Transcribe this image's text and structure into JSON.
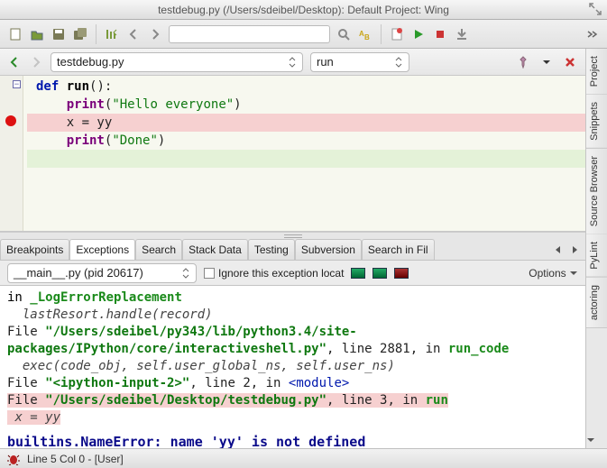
{
  "window": {
    "title": "testdebug.py (/Users/sdeibel/Desktop): Default Project: Wing"
  },
  "file_tabs": {
    "file_combo": "testdebug.py",
    "run_combo": "run"
  },
  "editor": {
    "lines": [
      {
        "indent": 0,
        "kw": "def",
        "rest_html": "<span class='fn'>run</span>():",
        "hl": ""
      },
      {
        "indent": 1,
        "call": "print",
        "paren_open": "(",
        "str": "\"Hello everyone\"",
        "paren_close": ")",
        "hl": ""
      },
      {
        "indent": 1,
        "plain": "x = yy",
        "hl": "err"
      },
      {
        "indent": 1,
        "call": "print",
        "paren_open": "(",
        "str": "\"Done\"",
        "paren_close": ")",
        "hl": ""
      },
      {
        "indent": 0,
        "plain": "",
        "hl": "green"
      }
    ]
  },
  "panel_tabs": [
    "Breakpoints",
    "Exceptions",
    "Search",
    "Stack Data",
    "Testing",
    "Subversion",
    "Search in Fil"
  ],
  "panel_active_index": 1,
  "exceptions_bar": {
    "process_combo": "__main__.py (pid 20617)",
    "ignore_label": "Ignore this exception locat",
    "options_label": "Options"
  },
  "traceback": {
    "l1_prefix": "in ",
    "l1_fn": "_LogErrorReplacement",
    "l2": "lastResort.handle(record)",
    "l3_prefix": "File ",
    "l3_file": "\"/Users/sdeibel/py343/lib/python3.4/site-packages/IPython/core/interactiveshell.py\"",
    "l3_mid": ", line 2881, in ",
    "l3_fn": "run_code",
    "l4": "exec(code_obj, self.user_global_ns, self.user_ns)",
    "l5_prefix": "File ",
    "l5_file": "\"<ipython-input-2>\"",
    "l5_mid": ", line 2, in ",
    "l5_mod": "<module>",
    "l6_prefix": "File ",
    "l6_file": "\"/Users/sdeibel/Desktop/testdebug.py\"",
    "l6_mid": ", line 3, in ",
    "l6_fn": "run",
    "l7": "x = yy",
    "error": "builtins.NameError: name 'yy' is not defined"
  },
  "side_tabs": [
    "Project",
    "Snippets",
    "Source Browser",
    "PyLint",
    "actoring"
  ],
  "statusbar": {
    "text": "Line 5 Col 0 - [User]"
  }
}
